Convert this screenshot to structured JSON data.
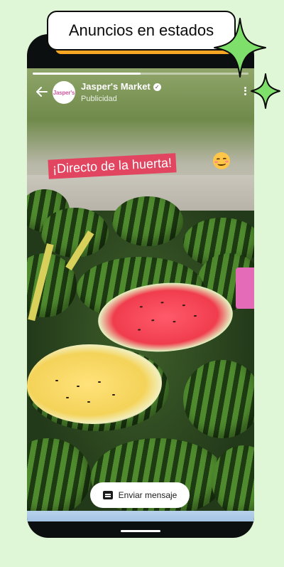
{
  "banner": {
    "title": "Anuncios en estados"
  },
  "status": {
    "progress": 0.5,
    "business_name": "Jasper's Market",
    "label": "Publicidad",
    "avatar_text": "Jasper's"
  },
  "ad": {
    "headline": "¡Directo de la huerta!",
    "cta_label": "Enviar mensaje"
  },
  "colors": {
    "background": "#dff7d6",
    "accent_orange": "#f6a623",
    "sparkle_green": "#7ee06a",
    "headline_bg": "#e14560"
  }
}
